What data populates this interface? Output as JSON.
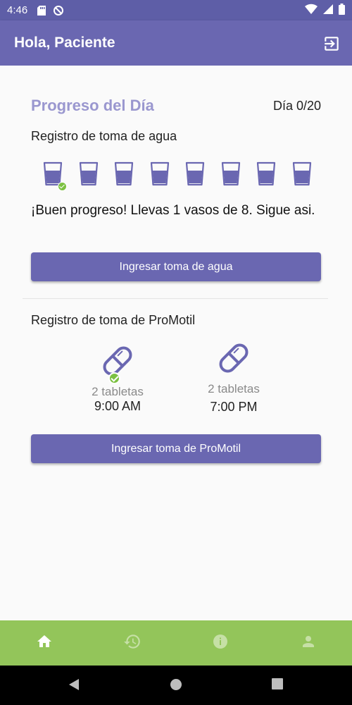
{
  "status_bar": {
    "time": "4:46"
  },
  "app_bar": {
    "title": "Hola, Paciente",
    "logout_icon": "logout-icon"
  },
  "progress": {
    "title": "Progreso del Día",
    "day_counter": "Día 0/20",
    "water_label": "Registro de toma de agua",
    "glasses_total": 8,
    "glasses_taken": 1,
    "message": "¡Buen progreso! Llevas 1 vasos de 8. Sigue asi.",
    "water_button": "Ingresar toma de agua"
  },
  "pills": {
    "label": "Registro de toma de ProMotil",
    "doses": [
      {
        "amount": "2 tabletas",
        "time": "9:00 AM",
        "taken": true
      },
      {
        "amount": "2 tabletas",
        "time": "7:00 PM",
        "taken": false
      }
    ],
    "button": "Ingresar toma de ProMotil"
  },
  "bottom_nav": {
    "items": [
      {
        "icon": "home-icon",
        "active": true
      },
      {
        "icon": "history-icon",
        "active": false
      },
      {
        "icon": "info-icon",
        "active": false
      },
      {
        "icon": "person-icon",
        "active": false
      }
    ]
  },
  "colors": {
    "primary": "#6a67b1",
    "title_accent": "#9a97cf",
    "nav_green": "#93c55a",
    "check_green": "#7cc142"
  }
}
